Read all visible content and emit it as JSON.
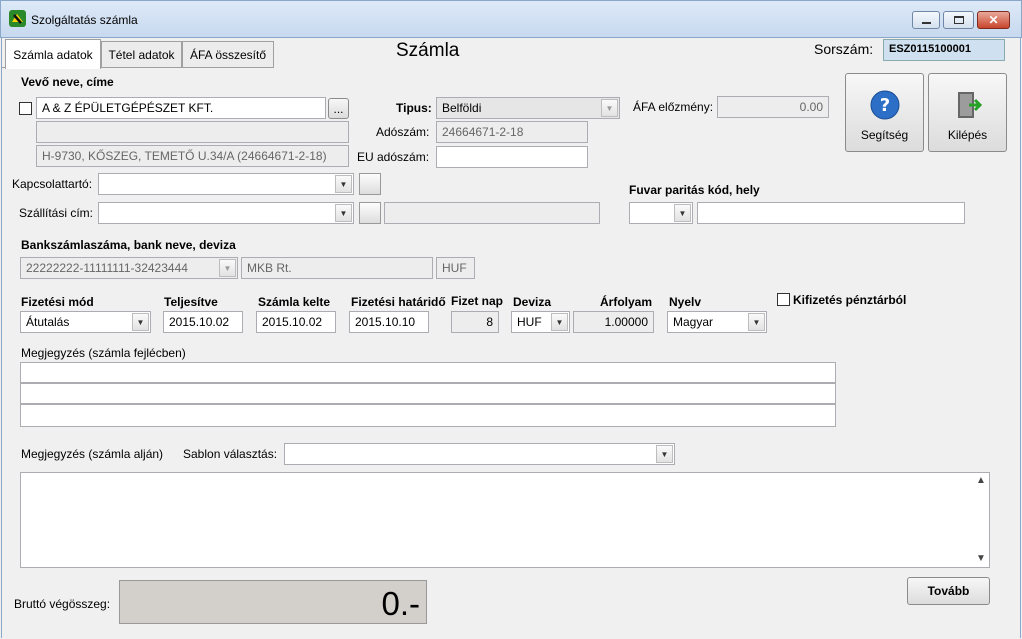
{
  "window": {
    "title": "Szolgáltatás számla"
  },
  "tabs": [
    {
      "label": "Számla adatok"
    },
    {
      "label": "Tétel adatok"
    },
    {
      "label": "ÁFA összesítő"
    }
  ],
  "header": {
    "title": "Számla",
    "serial_label": "Sorszám:",
    "serial_value": "ESZ0115100001"
  },
  "buyer": {
    "section_label": "Vevő neve, címe",
    "name": "A & Z ÉPÜLETGÉPÉSZET KFT.",
    "browse_label": "...",
    "line2": "",
    "address": "H-9730, KŐSZEG, TEMETŐ U.34/A (24664671-2-18)"
  },
  "tipus": {
    "label": "Tipus:",
    "value": "Belföldi"
  },
  "adoszam": {
    "label": "Adószám:",
    "value": "24664671-2-18"
  },
  "eu_adoszam": {
    "label": "EU adószám:",
    "value": ""
  },
  "afa_elozmeny": {
    "label": "ÁFA előzmény:",
    "value": "0.00"
  },
  "buttons": {
    "help": "Segítség",
    "exit": "Kilépés",
    "next": "Tovább"
  },
  "kapcsolattarto": {
    "label": "Kapcsolattartó:",
    "value": ""
  },
  "szallitasi_cim": {
    "label": "Szállítási cím:",
    "value": "",
    "extra": ""
  },
  "fuvar": {
    "label": "Fuvar paritás kód, hely",
    "code": "",
    "place": ""
  },
  "bank": {
    "label": "Bankszámlaszáma, bank neve, deviza",
    "account": "22222222-11111111-32423444",
    "bank_name": "MKB Rt.",
    "currency": "HUF"
  },
  "payment": {
    "mode_label": "Fizetési mód",
    "mode": "Átutalás",
    "teljesites_label": "Teljesítve",
    "teljesites": "2015.10.02",
    "kelte_label": "Számla kelte",
    "kelte": "2015.10.02",
    "hatarido_label": "Fizetési határidő",
    "hatarido": "2015.10.10",
    "fizetnap_label": "Fizet nap",
    "fizetnap": "8",
    "deviza_label": "Deviza",
    "deviza": "HUF",
    "arfolyam_label": "Árfolyam",
    "arfolyam": "1.00000",
    "nyelv_label": "Nyelv",
    "nyelv": "Magyar",
    "cash_label": "Kifizetés pénztárból"
  },
  "note_header": {
    "label": "Megjegyzés (számla fejlécben)"
  },
  "note_footer": {
    "label": "Megjegyzés (számla alján)",
    "template_label": "Sablon választás:",
    "template_value": ""
  },
  "total": {
    "label": "Bruttó végösszeg:",
    "value": "0.-"
  }
}
